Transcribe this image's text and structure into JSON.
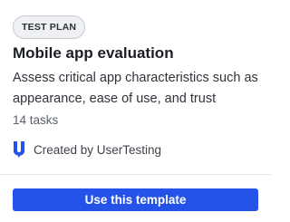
{
  "card": {
    "badge": "TEST PLAN",
    "title": "Mobile app evaluation",
    "description": "Assess critical app characteristics such as appearance, ease of use, and trust",
    "tasks": "14 tasks",
    "creator": {
      "icon": "usertesting-logo-icon",
      "label": "Created by UserTesting"
    },
    "cta_label": "Use this template"
  },
  "colors": {
    "brand": "#2553ea",
    "badge_bg": "#eef0f3",
    "title_text": "#1b1e24"
  }
}
